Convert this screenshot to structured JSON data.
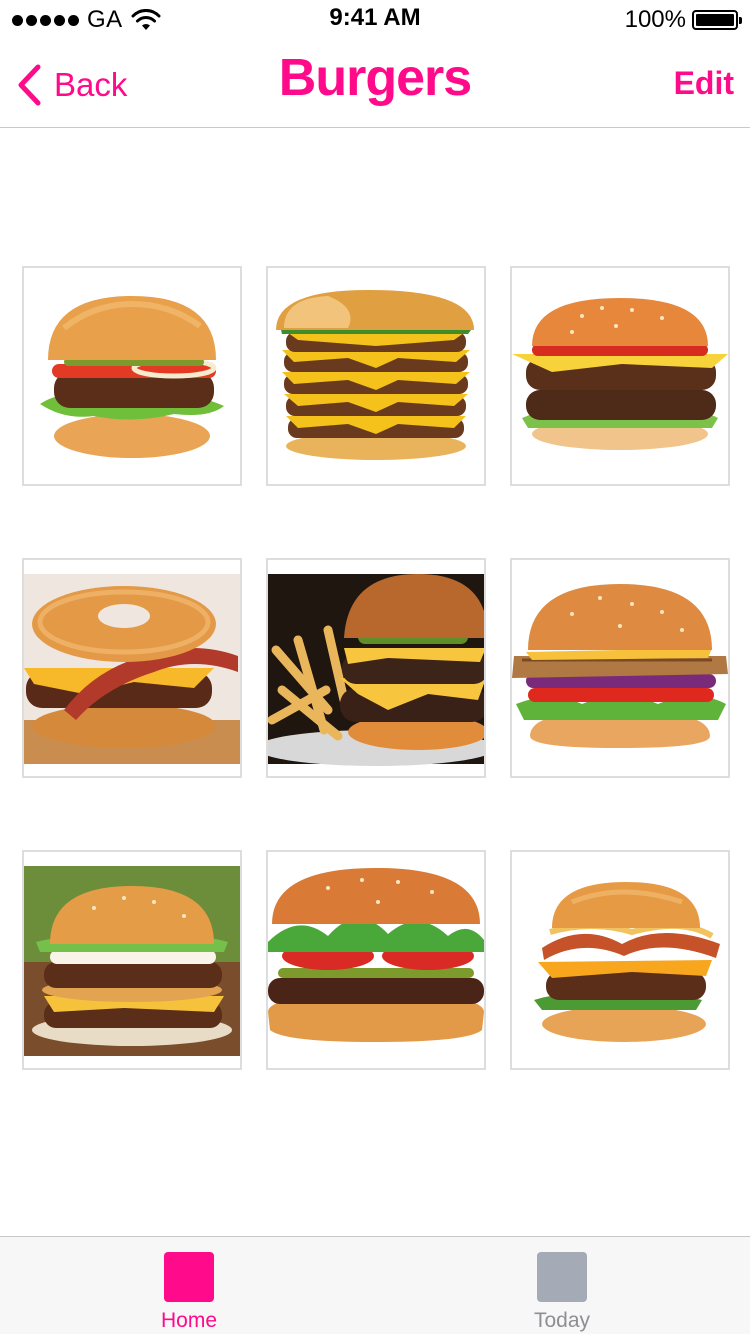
{
  "status_bar": {
    "carrier": "GA",
    "time": "9:41 AM",
    "battery": "100%",
    "battery_level": 1.0
  },
  "nav": {
    "back_label": "Back",
    "title": "Burgers",
    "edit_label": "Edit"
  },
  "grid": {
    "items": [
      {
        "name": "burger-photo",
        "icon": "burger-image"
      },
      {
        "name": "burger-photo",
        "icon": "burger-image"
      },
      {
        "name": "burger-photo",
        "icon": "burger-image"
      },
      {
        "name": "burger-photo",
        "icon": "burger-image"
      },
      {
        "name": "burger-photo",
        "icon": "burger-image"
      },
      {
        "name": "burger-photo",
        "icon": "burger-image"
      },
      {
        "name": "burger-photo",
        "icon": "burger-image"
      },
      {
        "name": "burger-photo",
        "icon": "burger-image"
      },
      {
        "name": "burger-photo",
        "icon": "burger-image"
      }
    ]
  },
  "tab_bar": {
    "tabs": [
      {
        "label": "Home",
        "selected": true
      },
      {
        "label": "Today",
        "selected": false
      }
    ]
  },
  "colors": {
    "accent": "#ff0a8a",
    "tab_inactive": "#a4abb6",
    "tab_label_inactive": "#8e8e93",
    "tile_border": "#dddddd"
  }
}
